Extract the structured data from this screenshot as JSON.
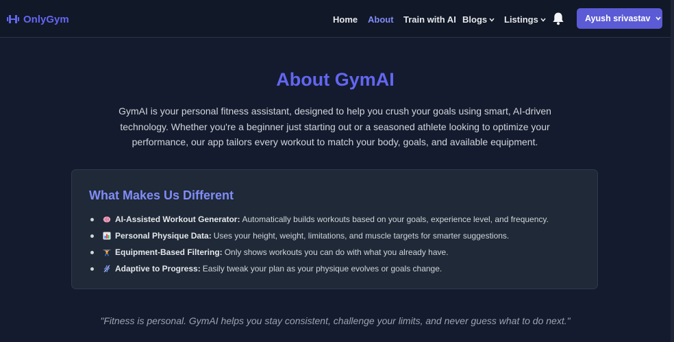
{
  "brand": {
    "name": "OnlyGym",
    "icon": "dumbbell-icon"
  },
  "nav": {
    "links": [
      {
        "label": "Home",
        "active": false,
        "dropdown": false
      },
      {
        "label": "About",
        "active": true,
        "dropdown": false
      },
      {
        "label": "Train with AI",
        "active": false,
        "dropdown": false
      },
      {
        "label": "Blogs",
        "active": false,
        "dropdown": true
      },
      {
        "label": "Listings",
        "active": false,
        "dropdown": true
      }
    ],
    "notification_icon": "bell-icon",
    "user_button": "Ayush srivastav"
  },
  "about": {
    "title": "About GymAI",
    "intro": "GymAI is your personal fitness assistant, designed to help you crush your goals using smart, AI-driven technology. Whether you're a beginner just starting out or a seasoned athlete looking to optimize your performance, our app tailors every workout to match your body, goals, and available equipment."
  },
  "different": {
    "title": "What Makes Us Different",
    "features": [
      {
        "icon": "brain-icon",
        "name": "AI-Assisted Workout Generator:",
        "text": "Automatically builds workouts based on your goals, experience level, and frequency."
      },
      {
        "icon": "bar-chart-icon",
        "name": "Personal Physique Data:",
        "text": "Uses your height, weight, limitations, and muscle targets for smarter suggestions."
      },
      {
        "icon": "weightlifter-icon",
        "name": "Equipment-Based Filtering:",
        "text": "Only shows workouts you can do with what you already have."
      },
      {
        "icon": "dna-icon",
        "name": "Adaptive to Progress:",
        "text": "Easily tweak your plan as your physique evolves or goals change."
      }
    ]
  },
  "quote": "\"Fitness is personal. GymAI helps you stay consistent, challenge your limits, and never guess what to do next.\"",
  "colors": {
    "accent": "#6366f1",
    "background": "#141b2e",
    "navbar": "#111827",
    "card": "#1f2937",
    "button": "#5b5bd6"
  }
}
